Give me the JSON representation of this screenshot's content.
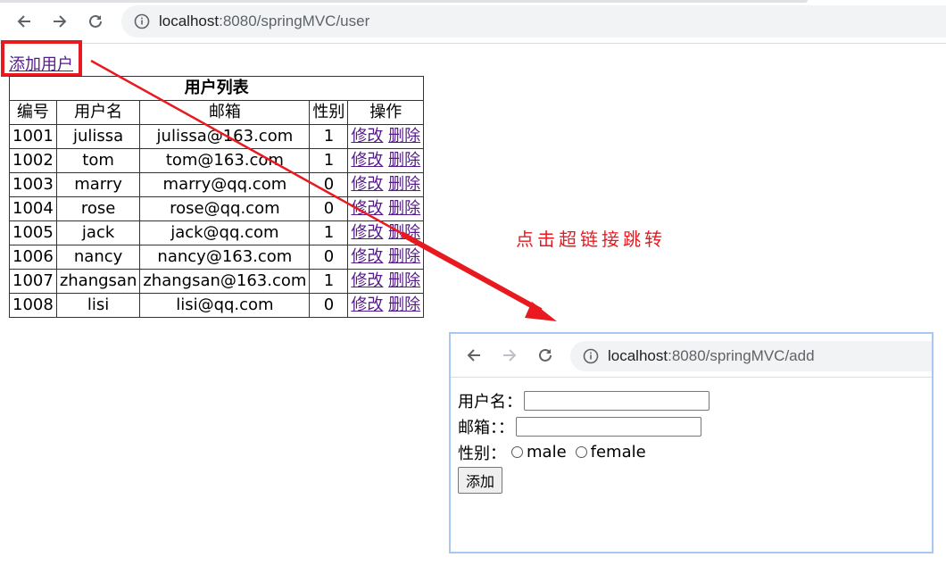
{
  "browser": {
    "url_host": "localhost",
    "url_path": ":8080/springMVC/user"
  },
  "page": {
    "add_link": "添加用户",
    "table": {
      "caption": "用户列表",
      "headers": [
        "编号",
        "用户名",
        "邮箱",
        "性别",
        "操作"
      ],
      "rows": [
        [
          "1001",
          "julissa",
          "julissa@163.com",
          "1"
        ],
        [
          "1002",
          "tom",
          "tom@163.com",
          "1"
        ],
        [
          "1003",
          "marry",
          "marry@qq.com",
          "0"
        ],
        [
          "1004",
          "rose",
          "rose@qq.com",
          "0"
        ],
        [
          "1005",
          "jack",
          "jack@qq.com",
          "1"
        ],
        [
          "1006",
          "nancy",
          "nancy@163.com",
          "0"
        ],
        [
          "1007",
          "zhangsan",
          "zhangsan@163.com",
          "1"
        ],
        [
          "1008",
          "lisi",
          "lisi@qq.com",
          "0"
        ]
      ],
      "edit_label": "修改",
      "delete_label": "删除"
    }
  },
  "annotation": {
    "text": "点击超链接跳转",
    "color": "#e8191f"
  },
  "popup": {
    "url_host": "localhost",
    "url_path": ":8080/springMVC/add",
    "form": {
      "username_label": "用户名：",
      "email_label": "邮箱：：",
      "gender_label": "性别：",
      "male_label": "male",
      "female_label": "female",
      "submit_label": "添加"
    }
  }
}
